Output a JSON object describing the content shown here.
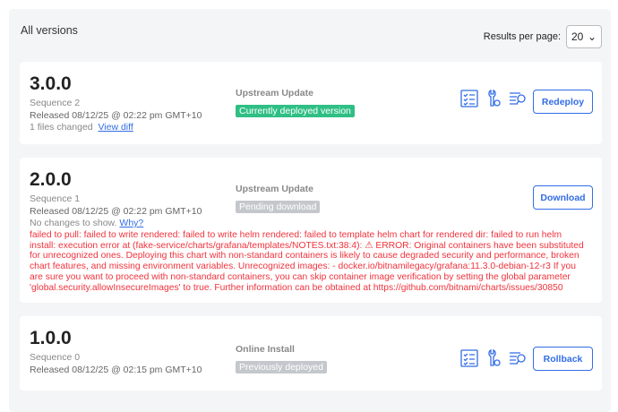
{
  "header": {
    "title": "All versions",
    "results_label": "Results per page:",
    "results_value": "20"
  },
  "colors": {
    "accent": "#326de6",
    "deployed": "#2fbf84",
    "muted_badge": "#c4c8cc",
    "error": "#f0323c"
  },
  "versions": [
    {
      "version": "3.0.0",
      "sequence": "Sequence 2",
      "released": "Released 08/12/25 @ 02:22 pm GMT+10",
      "changes": "1 files changed",
      "diff_link": "View diff",
      "source": "Upstream Update",
      "status": "Currently deployed version",
      "action": "Redeploy"
    },
    {
      "version": "2.0.0",
      "sequence": "Sequence 1",
      "released": "Released 08/12/25 @ 02:22 pm GMT+10",
      "changes": "No changes to show.",
      "why_link": "Why?",
      "source": "Upstream Update",
      "status": "Pending download",
      "action": "Download",
      "error": "failed to pull: failed to write rendered: failed to write helm rendered: failed to template helm chart for rendered dir: failed to run helm install: execution error at (fake-service/charts/grafana/templates/NOTES.txt:38:4): ⚠ ERROR: Original containers have been substituted for unrecognized ones. Deploying this chart with non-standard containers is likely to cause degraded security and performance, broken chart features, and missing environment variables. Unrecognized images: - docker.io/bitnamilegacy/grafana:11.3.0-debian-12-r3 If you are sure you want to proceed with non-standard containers, you can skip container image verification by setting the global parameter 'global.security.allowInsecureImages' to true. Further information can be obtained at https://github.com/bitnami/charts/issues/30850"
    },
    {
      "version": "1.0.0",
      "sequence": "Sequence 0",
      "released": "Released 08/12/25 @ 02:15 pm GMT+10",
      "source": "Online Install",
      "status": "Previously deployed",
      "action": "Rollback"
    }
  ]
}
